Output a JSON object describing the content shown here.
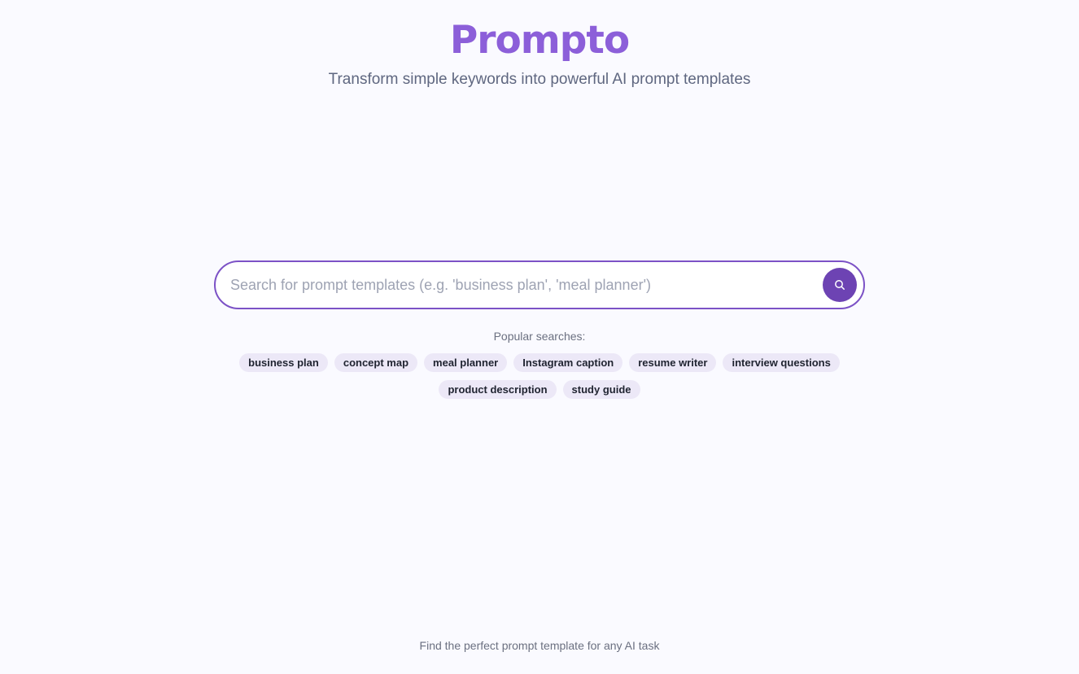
{
  "header": {
    "title": "Prompto",
    "tagline": "Transform simple keywords into powerful AI prompt templates"
  },
  "search": {
    "placeholder": "Search for prompt templates (e.g. 'business plan', 'meal planner')",
    "value": "",
    "button_icon": "search-icon"
  },
  "popular": {
    "label": "Popular searches:",
    "chips": [
      "business plan",
      "concept map",
      "meal planner",
      "Instagram caption",
      "resume writer",
      "interview questions",
      "product description",
      "study guide"
    ]
  },
  "footer": {
    "text": "Find the perfect prompt template for any AI task"
  },
  "colors": {
    "brand": "#8c5fd9",
    "accent": "#6d43b3",
    "chip_bg": "#ece8f7",
    "page_bg": "#fafaff"
  }
}
